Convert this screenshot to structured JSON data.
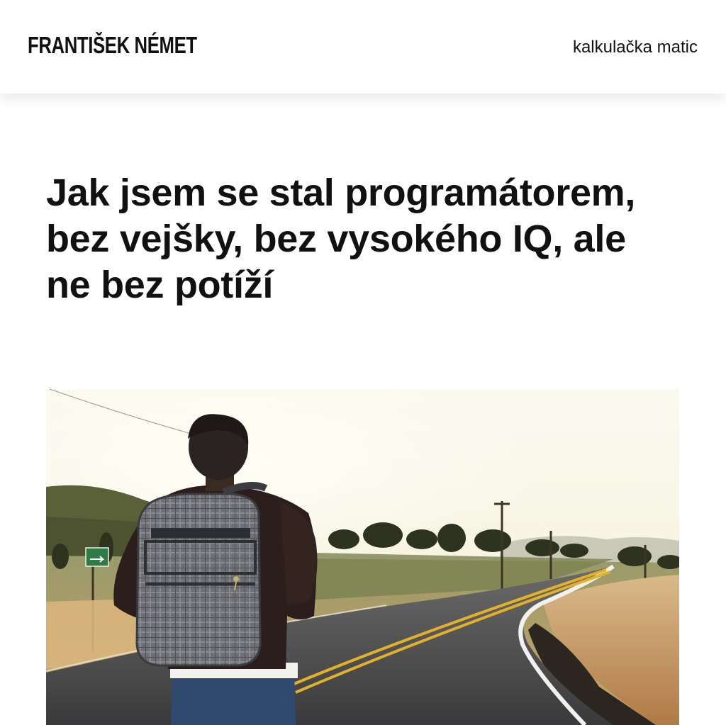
{
  "header": {
    "logo_text": "FRANTIŠEK NÉMET",
    "nav_link": "kalkulačka matic"
  },
  "article": {
    "title": "Jak jsem se stal programátorem, bez vejšky, bez vysokého IQ, ale ne bez potíží"
  },
  "hero_image": {
    "subject": "backpacker-on-road-photo"
  }
}
